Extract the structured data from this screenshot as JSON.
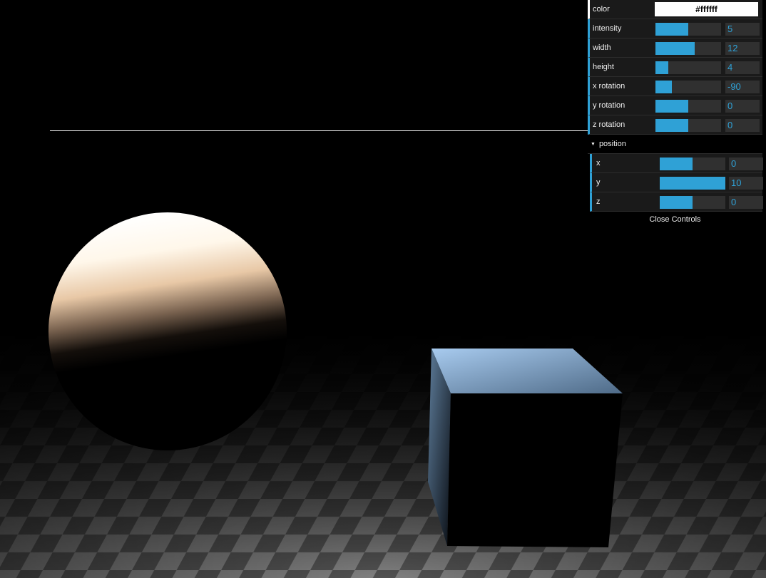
{
  "gui": {
    "color": {
      "label": "color",
      "value": "#ffffff"
    },
    "controls": [
      {
        "id": "intensity",
        "label": "intensity",
        "value": "5",
        "fill": 0.5
      },
      {
        "id": "width",
        "label": "width",
        "value": "12",
        "fill": 0.6
      },
      {
        "id": "height",
        "label": "height",
        "value": "4",
        "fill": 0.2
      },
      {
        "id": "x-rotation",
        "label": "x rotation",
        "value": "-90",
        "fill": 0.25
      },
      {
        "id": "y-rotation",
        "label": "y rotation",
        "value": "0",
        "fill": 0.5
      },
      {
        "id": "z-rotation",
        "label": "z rotation",
        "value": "0",
        "fill": 0.5
      }
    ],
    "position_folder": {
      "title": "position",
      "controls": [
        {
          "id": "x",
          "label": "x",
          "value": "0",
          "fill": 0.5
        },
        {
          "id": "y",
          "label": "y",
          "value": "10",
          "fill": 1.0
        },
        {
          "id": "z",
          "label": "z",
          "value": "0",
          "fill": 0.5
        }
      ]
    },
    "close_label": "Close Controls"
  },
  "colors": {
    "accent": "#2fa1d6",
    "panel_bg": "#1a1a1a",
    "slider_bg": "#303030",
    "cube": "#9cc2e8",
    "sphere": "#ffe4c4"
  }
}
